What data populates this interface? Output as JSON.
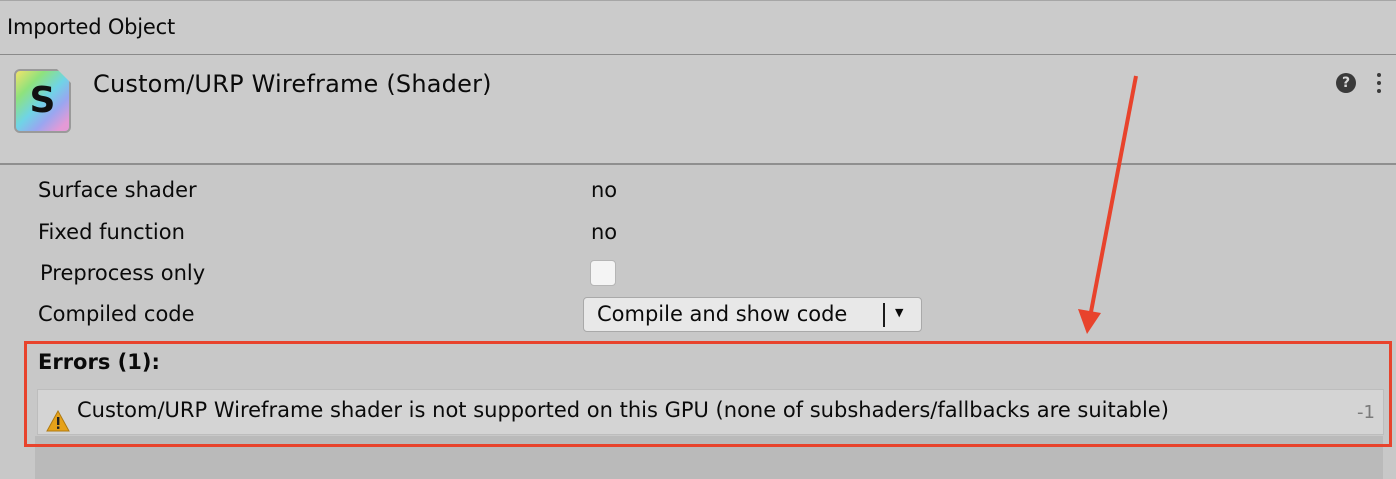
{
  "topbar": {
    "title": "Imported Object"
  },
  "header": {
    "icon_letter": "S",
    "object_title": "Custom/URP Wireframe (Shader)",
    "help_icon": "question-circle-icon",
    "menu_icon": "vertical-ellipsis-icon"
  },
  "properties": [
    {
      "label": "Surface shader",
      "value": "no"
    },
    {
      "label": "Fixed function",
      "value": "no"
    },
    {
      "label": "Preprocess only",
      "checked": false
    },
    {
      "label": "Compiled code",
      "dropdown": "Compile and show code"
    }
  ],
  "errors": {
    "title": "Errors (1):",
    "items": [
      {
        "icon": "warning-icon",
        "message": "Custom/URP Wireframe shader is not supported on this GPU (none of subshaders/fallbacks are suitable)",
        "line": "-1"
      }
    ]
  },
  "annotation": {
    "color": "#e8432c"
  }
}
